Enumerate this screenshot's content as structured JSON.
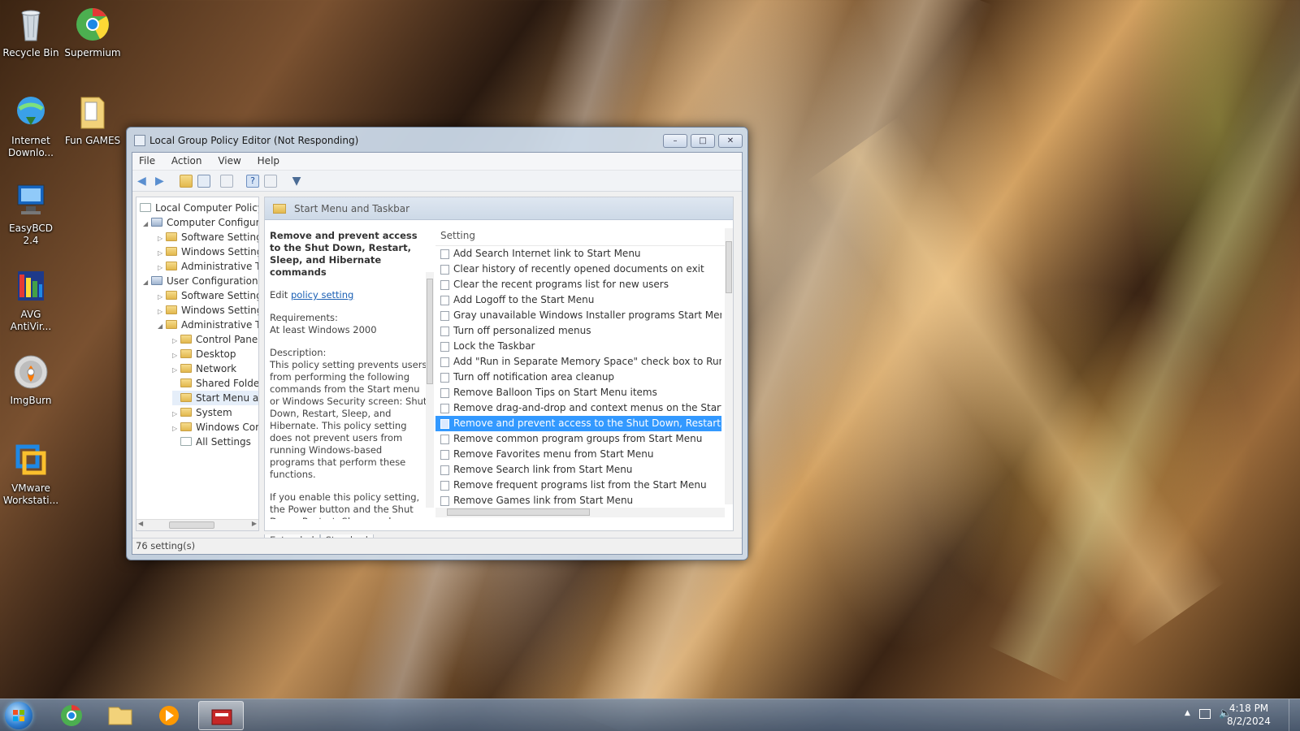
{
  "desktop": {
    "icons": [
      {
        "label": "Recycle Bin"
      },
      {
        "label": "Supermium"
      },
      {
        "label": "Internet Downlo..."
      },
      {
        "label": "Fun GAMES"
      },
      {
        "label": "EasyBCD 2.4"
      },
      {
        "label": "AVG AntiVir..."
      },
      {
        "label": "ImgBurn"
      },
      {
        "label": "VMware Workstati..."
      }
    ]
  },
  "window": {
    "title": "Local Group Policy Editor (Not Responding)",
    "menu": [
      "File",
      "Action",
      "View",
      "Help"
    ],
    "tree": [
      {
        "label": "Local Computer Policy"
      },
      {
        "label": "Computer Configura"
      },
      {
        "label": "Software Settings"
      },
      {
        "label": "Windows Setting"
      },
      {
        "label": "Administrative Te"
      },
      {
        "label": "User Configuration"
      },
      {
        "label": "Software Settings"
      },
      {
        "label": "Windows Setting"
      },
      {
        "label": "Administrative Te"
      },
      {
        "label": "Control Panel"
      },
      {
        "label": "Desktop"
      },
      {
        "label": "Network"
      },
      {
        "label": "Shared Folder"
      },
      {
        "label": "Start Menu ar"
      },
      {
        "label": "System"
      },
      {
        "label": "Windows Cor"
      },
      {
        "label": "All Settings"
      }
    ],
    "header": "Start Menu and Taskbar",
    "description": {
      "title": "Remove and prevent access to the Shut Down, Restart, Sleep, and Hibernate commands",
      "edit_prefix": "Edit",
      "edit_link": "policy setting",
      "requirements_label": "Requirements:",
      "requirements_value": "At least Windows 2000",
      "description_label": "Description:",
      "description_text": "This policy setting prevents users from performing the following commands from the Start menu or Windows Security screen: Shut Down, Restart, Sleep, and Hibernate. This policy setting does not prevent users from running Windows-based programs that perform these functions.",
      "enable_text": "If you enable this policy setting, the Power button and the Shut Down, Restart, Sleep, and Hibernate commands are"
    },
    "list": {
      "column": "Setting",
      "rows": [
        "Add Search Internet link to Start Menu",
        "Clear history of recently opened documents on exit",
        "Clear the recent programs list for new users",
        "Add Logoff to the Start Menu",
        "Gray unavailable Windows Installer programs Start Menu sh...",
        "Turn off personalized menus",
        "Lock the Taskbar",
        "Add \"Run in Separate Memory Space\" check box to Run dial...",
        "Turn off notification area cleanup",
        "Remove Balloon Tips on Start Menu items",
        "Remove drag-and-drop and context menus on the Start Me...",
        "Remove and prevent access to the Shut Down, Restart, Sleep...",
        "Remove common program groups from Start Menu",
        "Remove Favorites menu from Start Menu",
        "Remove Search link from Start Menu",
        "Remove frequent programs list from the Start Menu",
        "Remove Games link from Start Menu"
      ],
      "selected_index": 11
    },
    "tabs": [
      "Extended",
      "Standard"
    ],
    "status": "76 setting(s)"
  },
  "taskbar": {
    "time": "4:18 PM",
    "date": "8/2/2024"
  },
  "colors": {
    "selection": "#3399ff",
    "link": "#1a5fb4",
    "taskbar": "#4b5c73"
  }
}
